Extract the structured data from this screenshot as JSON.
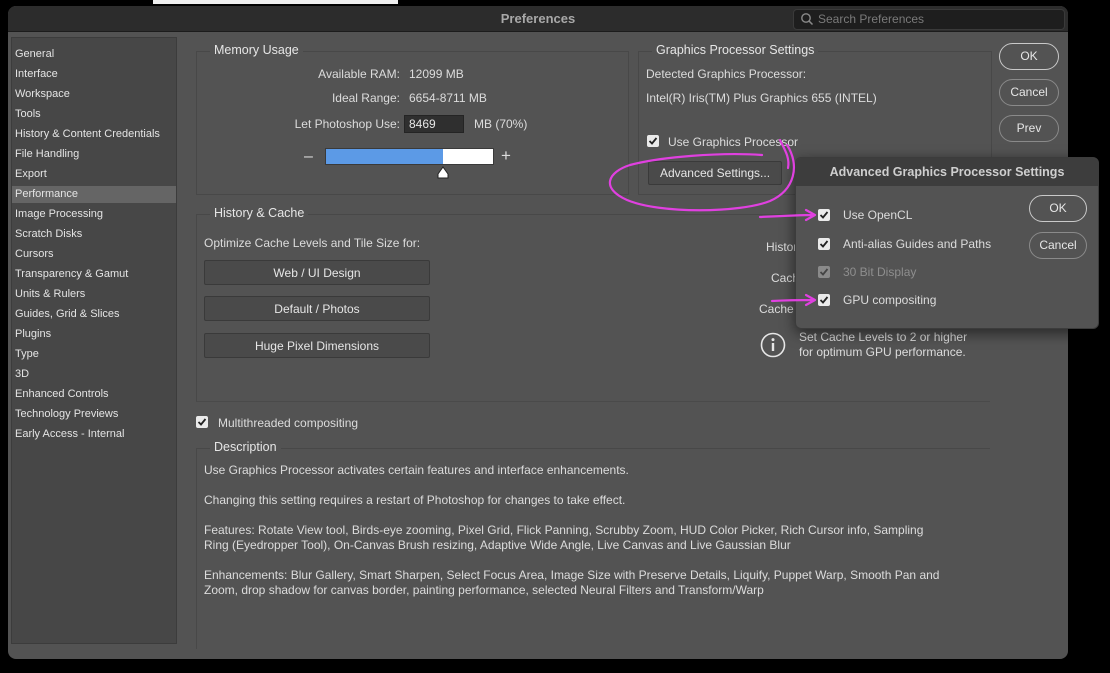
{
  "window": {
    "title": "Preferences",
    "search_placeholder": "Search Preferences"
  },
  "sidebar": {
    "selected_index": 7,
    "items": [
      {
        "label": "General"
      },
      {
        "label": "Interface"
      },
      {
        "label": "Workspace"
      },
      {
        "label": "Tools"
      },
      {
        "label": "History & Content Credentials"
      },
      {
        "label": "File Handling"
      },
      {
        "label": "Export"
      },
      {
        "label": "Performance"
      },
      {
        "label": "Image Processing"
      },
      {
        "label": "Scratch Disks"
      },
      {
        "label": "Cursors"
      },
      {
        "label": "Transparency & Gamut"
      },
      {
        "label": "Units & Rulers"
      },
      {
        "label": "Guides, Grid & Slices"
      },
      {
        "label": "Plugins"
      },
      {
        "label": "Type"
      },
      {
        "label": "3D"
      },
      {
        "label": "Enhanced Controls"
      },
      {
        "label": "Technology Previews"
      },
      {
        "label": "Early Access - Internal"
      }
    ]
  },
  "memory": {
    "title": "Memory Usage",
    "available_label": "Available RAM:",
    "available_value": "12099 MB",
    "ideal_label": "Ideal Range:",
    "ideal_value": "6654-8711 MB",
    "let_label": "Let Photoshop Use:",
    "let_value": "8469",
    "let_suffix": "MB (70%)",
    "slider_percent": 70,
    "minus": "–",
    "plus": "+"
  },
  "gpu": {
    "title": "Graphics Processor Settings",
    "detected_label": "Detected Graphics Processor:",
    "detected_value": "Intel(R) Iris(TM) Plus Graphics 655 (INTEL)",
    "use_gpu_label": "Use Graphics Processor",
    "use_gpu_checked": true,
    "advanced_button": "Advanced Settings..."
  },
  "dialog_buttons": {
    "ok": "OK",
    "cancel": "Cancel",
    "prev": "Prev"
  },
  "history": {
    "title": "History & Cache",
    "optimize_label": "Optimize Cache Levels and Tile Size for:",
    "buttons": [
      "Web / UI Design",
      "Default / Photos",
      "Huge Pixel Dimensions"
    ],
    "labels_partial": [
      "Histor",
      "Cach",
      "Cache"
    ],
    "info_text_1": "Set Cache Levels to 2 or higher",
    "info_text_2": "for optimum GPU performance."
  },
  "multithreaded": {
    "label": "Multithreaded compositing",
    "checked": true
  },
  "description": {
    "title": "Description",
    "p1": "Use Graphics Processor activates certain features and interface enhancements.",
    "p2": "Changing this setting requires a restart of Photoshop for changes to take effect.",
    "p3a": "Features: Rotate View tool, Birds-eye zooming, Pixel Grid, Flick Panning, Scrubby Zoom, HUD Color Picker, Rich Cursor info, Sampling",
    "p3b": "Ring (Eyedropper Tool), On-Canvas Brush resizing, Adaptive Wide Angle, Live Canvas and Live Gaussian Blur",
    "p4a": "Enhancements: Blur Gallery, Smart Sharpen, Select Focus Area, Image Size with Preserve Details, Liquify, Puppet Warp, Smooth Pan and",
    "p4b": "Zoom, drop shadow for canvas border, painting performance, selected Neural Filters and Transform/Warp"
  },
  "advanced_popup": {
    "title": "Advanced Graphics Processor Settings",
    "options": [
      {
        "label": "Use OpenCL",
        "checked": true,
        "disabled": false
      },
      {
        "label": "Anti-alias Guides and Paths",
        "checked": true,
        "disabled": false
      },
      {
        "label": "30 Bit Display",
        "checked": true,
        "disabled": true
      },
      {
        "label": "GPU compositing",
        "checked": true,
        "disabled": false
      }
    ],
    "ok": "OK",
    "cancel": "Cancel"
  },
  "colors": {
    "window_bg": "#535353",
    "slider_fill": "#5c9ae6",
    "annotation": "#e040e0"
  }
}
